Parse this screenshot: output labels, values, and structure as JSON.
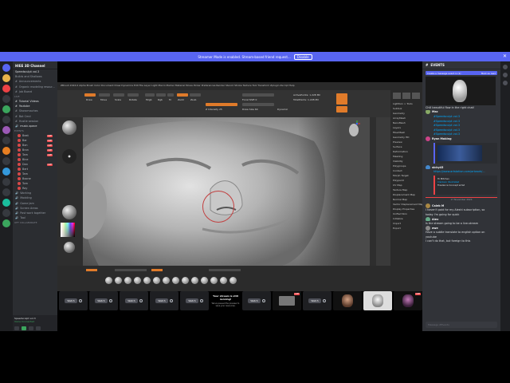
{
  "banner": {
    "text": "Streamer Mode is enabled. Stream-based friend request...",
    "button": "Disable"
  },
  "server": {
    "name": "HIEE 3D Channel",
    "speedsculpt_header": "Speedsculpt vol.3",
    "speedsculpt_sub": "Builds and Shallows",
    "category_live": "LIVE",
    "category_live_events": "EVENTS",
    "category_voice": "VOICE CHANNELS",
    "category_offline": "OFF COLLABORATE",
    "channels": [
      "Announcements",
      "Organic modeling resour...",
      "Job Board",
      "Tutorial Videos",
      "Youtube",
      "Showrmaches",
      "Bot Cmd",
      "Hustle session",
      "music-space"
    ],
    "voice_users": [
      "Beat",
      "Bar",
      "Bon",
      "Bron",
      "Tam",
      "Bine",
      "Dan",
      "Bert",
      "Tam",
      "Boone",
      "Tom",
      "Ray"
    ],
    "lower_channels": [
      "Working",
      "Modding",
      "Game Jam",
      "Screen Areas",
      "Post work together",
      "Tool"
    ],
    "user_card": {
      "name": "Speedsculpt vol.3",
      "status": "Voice Connected"
    }
  },
  "zbrush": {
    "title_bar": "ZBrush 2024.0   Alpha Brush Color Document Draw Dynamics Edit File Layer Light Macro Marker Material Movie Picker Preferences Render Stencil Stroke Texture Tool Transform Zplugin Zscript Help",
    "labels": {
      "draw": "Draw",
      "move": "Move",
      "scale": "Scale",
      "rotate": "Rotate",
      "mrgb": "Mrgb",
      "rgb": "Rgb",
      "m": "M",
      "zadd": "Zadd",
      "zsub": "Zsub",
      "zintensity": "Z Intensity 25",
      "focal": "Focal Shift 0",
      "draw_size": "Draw Size 64",
      "dynamic": "Dynamic",
      "active_points": "ActivePoints: 1.228 Mil",
      "total_points": "TotalPoints: 1.228 Mil"
    },
    "tray_items": [
      "Tool",
      "Load Tool",
      "Save As",
      "Copy Tool",
      "Paste Tool",
      "Import",
      "Export",
      "Clone",
      "Make PolyMesh3D",
      "GoZ",
      "All",
      "Visible",
      "R",
      "Lightbox > Tools",
      "Subtool",
      "Geometry",
      "ArrayMesh",
      "NanoMesh",
      "Layers",
      "FiberMesh",
      "Geometry HD",
      "Preview",
      "Surface",
      "Deformation",
      "Masking",
      "Visibility",
      "Polygroups",
      "Contact",
      "Morph Target",
      "Polypaint",
      "UV Map",
      "Texture Map",
      "Displacement Map",
      "Normal Map",
      "Vector Displacement Map",
      "Display Properties",
      "Unified Skin",
      "Initialize",
      "Import",
      "Export"
    ]
  },
  "tiles": [
    {
      "type": "watch",
      "label": "Watch"
    },
    {
      "type": "watch",
      "label": "Watch"
    },
    {
      "type": "watch",
      "label": "Watch"
    },
    {
      "type": "watch",
      "label": "Watch"
    },
    {
      "type": "watch",
      "label": "Watch"
    },
    {
      "type": "msg",
      "title": "Your stream is still running!",
      "body": "We've paused the preview to save your resources."
    },
    {
      "type": "watch",
      "label": "Watch"
    },
    {
      "type": "img",
      "live": "LIVE"
    },
    {
      "type": "watch",
      "label": "Watch"
    },
    {
      "type": "img"
    },
    {
      "type": "img"
    },
    {
      "type": "img",
      "live": "LIVE"
    }
  ],
  "chat": {
    "header": "EVENTS",
    "banner_left": "Create a message event in (1)",
    "banner_right": "Mark as read",
    "messages": [
      {
        "kind": "text",
        "text": "Chill beautiful flow in the right chat!"
      },
      {
        "kind": "name",
        "text": "Mac"
      },
      {
        "kind": "link",
        "text": "#Speedsculpt vol.3"
      },
      {
        "kind": "link",
        "text": "#Speedsculpt vol.3"
      },
      {
        "kind": "link",
        "text": "#Speedsculpt vol.3"
      },
      {
        "kind": "link",
        "text": "#Speedsculpt vol.3"
      },
      {
        "kind": "link",
        "text": "#Speedsculpt vol.3"
      },
      {
        "kind": "name",
        "text": "Ryan Moking"
      },
      {
        "kind": "name",
        "text": "sicky45"
      },
      {
        "kind": "link",
        "text": "https://www.artstation.com/artwork/..."
      },
      {
        "kind": "text",
        "text": "Hi Mitchen"
      },
      {
        "kind": "text",
        "text": "Clarkson Illustrated"
      },
      {
        "kind": "text",
        "text": "Freelance Concept artist"
      }
    ],
    "divider": "17 November 2024",
    "later": [
      {
        "kind": "name",
        "text": "Caleb M"
      },
      {
        "kind": "text",
        "text": "I haven't paid for my Aleshi subscription, so"
      },
      {
        "kind": "text",
        "text": "today I'm going for quick"
      },
      {
        "kind": "name",
        "text": "Alex"
      },
      {
        "kind": "text",
        "text": "Is the stream going to be a live-stream"
      },
      {
        "kind": "name",
        "text": "ewe"
      },
      {
        "kind": "text",
        "text": "Have a subtle translate to english option on"
      },
      {
        "kind": "text",
        "text": "youtube"
      },
      {
        "kind": "text",
        "text": "I can't do that, but foreign to this"
      }
    ],
    "input_placeholder": "Message #Events"
  },
  "colors": {
    "accent": "#5865f2",
    "zb_orange": "#e07b2a",
    "live_red": "#ed4245"
  }
}
